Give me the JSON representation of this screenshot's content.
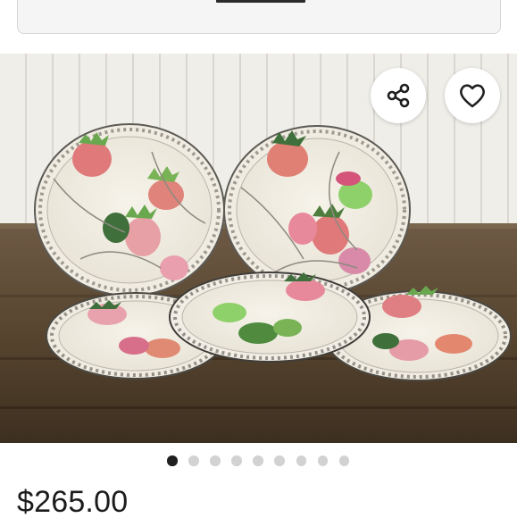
{
  "listing": {
    "photo": {
      "description_icon": "listing-photo",
      "current_index": 1,
      "total": 9
    },
    "actions": {
      "share_icon": "share-icon",
      "like_icon": "heart-icon"
    },
    "price": "$265.00"
  },
  "colors": {
    "accent_dark": "#1f1f1f",
    "dot_inactive": "#d2d2d2",
    "button_bg": "#ffffff"
  }
}
